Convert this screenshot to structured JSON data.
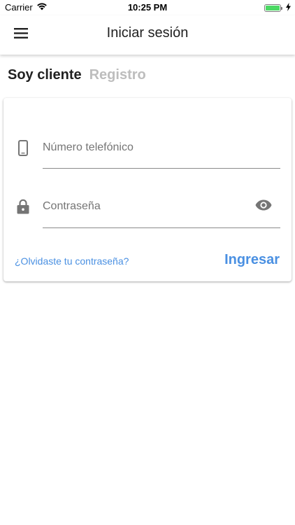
{
  "status_bar": {
    "carrier": "Carrier",
    "time": "10:25 PM",
    "battery_level": 1.0,
    "battery_color": "#4cd964"
  },
  "app_bar": {
    "menu_icon": "hamburger-menu-icon",
    "title": "Iniciar sesión"
  },
  "tabs": [
    {
      "label": "Soy cliente",
      "active": true
    },
    {
      "label": "Registro",
      "active": false
    }
  ],
  "form": {
    "phone": {
      "icon": "smartphone-icon",
      "placeholder": "Número telefónico",
      "value": ""
    },
    "password": {
      "icon": "lock-icon",
      "placeholder": "Contraseña",
      "value": "",
      "toggle_icon": "eye-icon"
    },
    "forgot_label": "¿Olvidaste tu contraseña?",
    "submit_label": "Ingresar"
  },
  "colors": {
    "accent": "#4a90e2",
    "inactive_tab": "#bdbdbd",
    "icon_gray": "#757575"
  }
}
